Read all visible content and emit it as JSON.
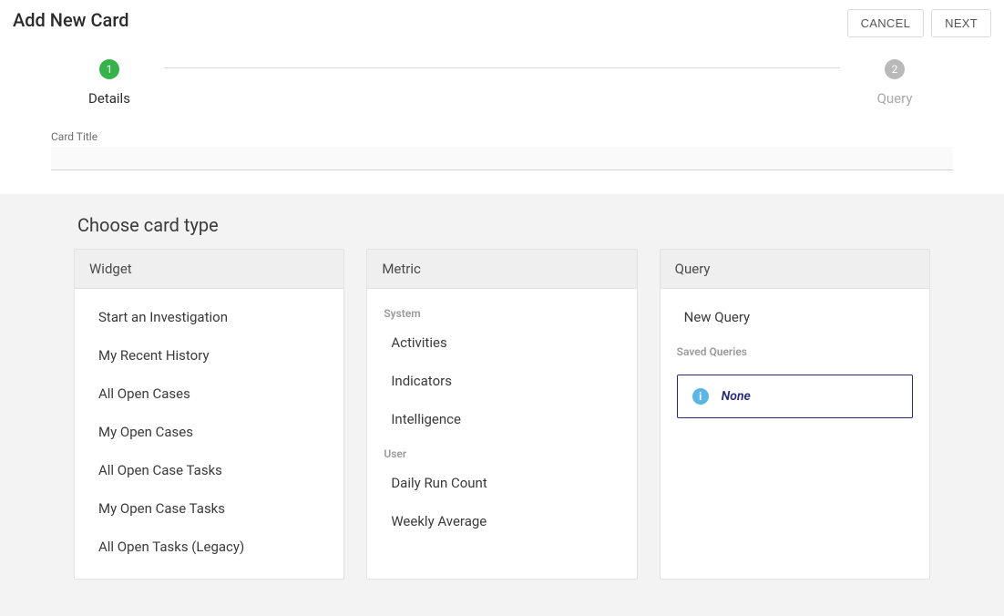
{
  "header": {
    "title": "Add New Card",
    "cancel": "CANCEL",
    "next": "NEXT"
  },
  "stepper": {
    "steps": [
      {
        "num": "1",
        "label": "Details",
        "active": true
      },
      {
        "num": "2",
        "label": "Query",
        "active": false
      }
    ]
  },
  "form": {
    "card_title_label": "Card Title",
    "card_title_value": ""
  },
  "choose": {
    "heading": "Choose card type",
    "columns": {
      "widget": {
        "header": "Widget",
        "items": [
          "Start an Investigation",
          "My Recent History",
          "All Open Cases",
          "My Open Cases",
          "All Open Case Tasks",
          "My Open Case Tasks",
          "All Open Tasks (Legacy)"
        ]
      },
      "metric": {
        "header": "Metric",
        "system_label": "System",
        "system_items": [
          "Activities",
          "Indicators",
          "Intelligence"
        ],
        "user_label": "User",
        "user_items": [
          "Daily Run Count",
          "Weekly Average"
        ]
      },
      "query": {
        "header": "Query",
        "new_query": "New Query",
        "saved_label": "Saved Queries",
        "none_text": "None"
      }
    }
  }
}
